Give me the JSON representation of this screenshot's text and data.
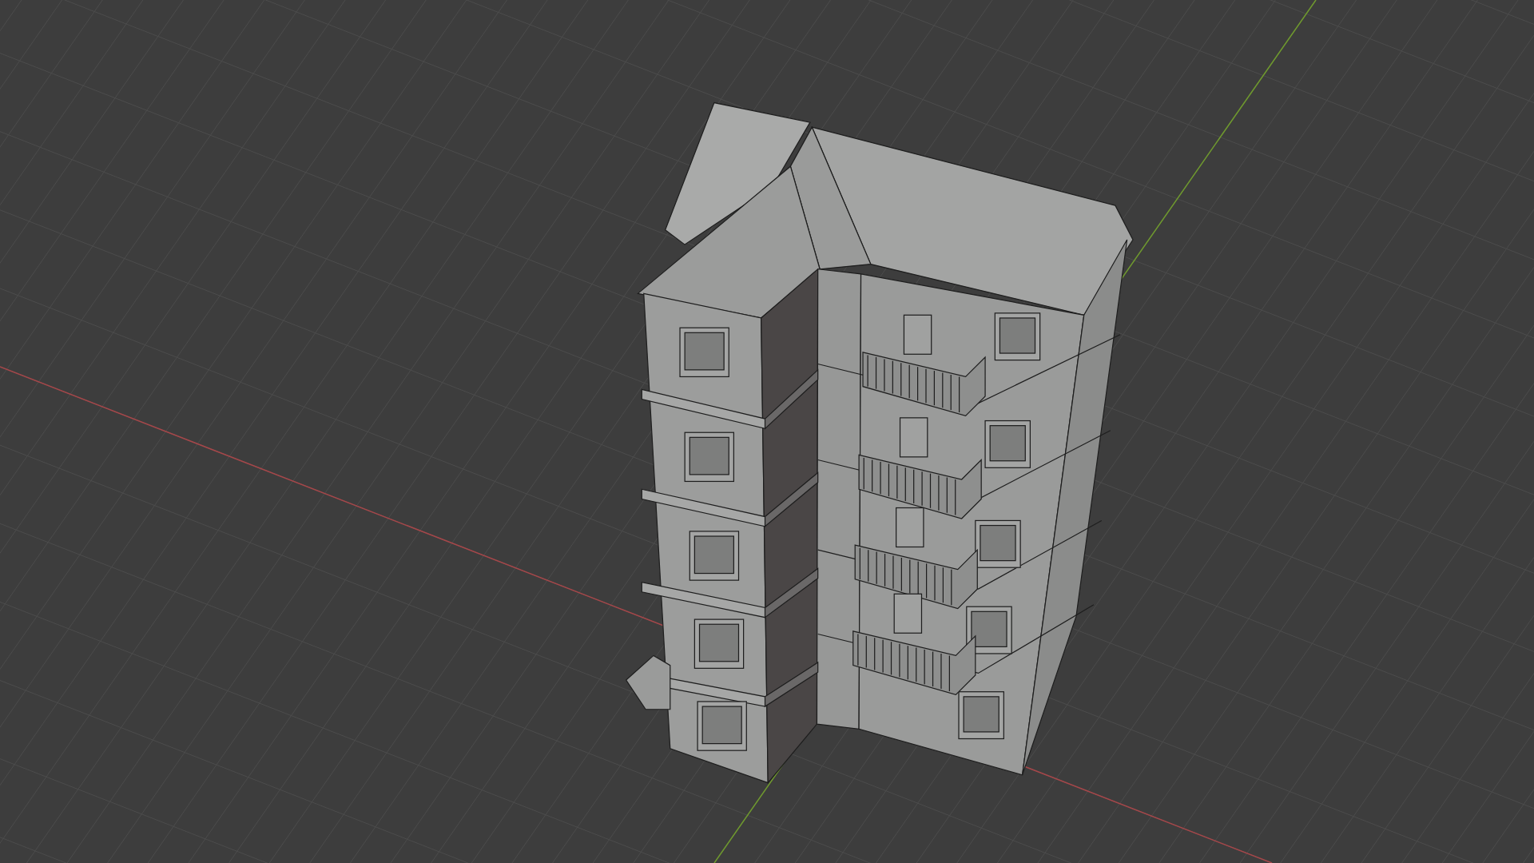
{
  "viewport": {
    "axes": [
      {
        "kind": "x",
        "color": "#a5474a"
      },
      {
        "kind": "y",
        "color": "#6f9a2e"
      }
    ]
  }
}
